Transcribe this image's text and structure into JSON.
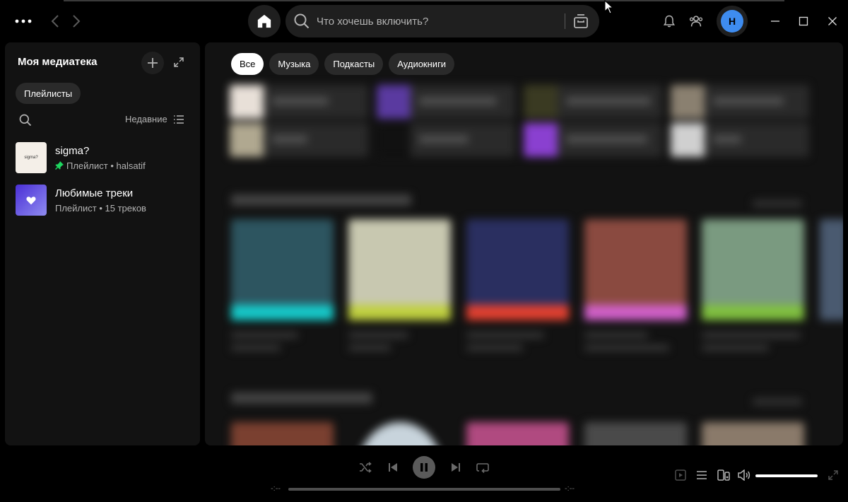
{
  "search": {
    "placeholder": "Что хочешь включить?"
  },
  "user": {
    "initial": "H"
  },
  "library": {
    "title": "Моя медиатека",
    "filter_chip": "Плейлисты",
    "sort_label": "Недавние",
    "items": [
      {
        "name": "sigma?",
        "cover_text": "sigma?",
        "subtitle": "Плейлист • halsatif",
        "pinned": true
      },
      {
        "name": "Любимые треки",
        "subtitle": "Плейлист • 15 треков",
        "pinned": false
      }
    ]
  },
  "main": {
    "filters": [
      {
        "label": "Все",
        "active": true
      },
      {
        "label": "Музыка",
        "active": false
      },
      {
        "label": "Подкасты",
        "active": false
      },
      {
        "label": "Аудиокниги",
        "active": false
      }
    ]
  },
  "player": {
    "time_elapsed": "-:--",
    "time_total": "-:--",
    "progress": 0,
    "volume": 1.0
  },
  "colors": {
    "accent_green": "#1ed760",
    "avatar": "#3e8cf0",
    "surface": "#121212",
    "chip": "#2a2a2a"
  }
}
